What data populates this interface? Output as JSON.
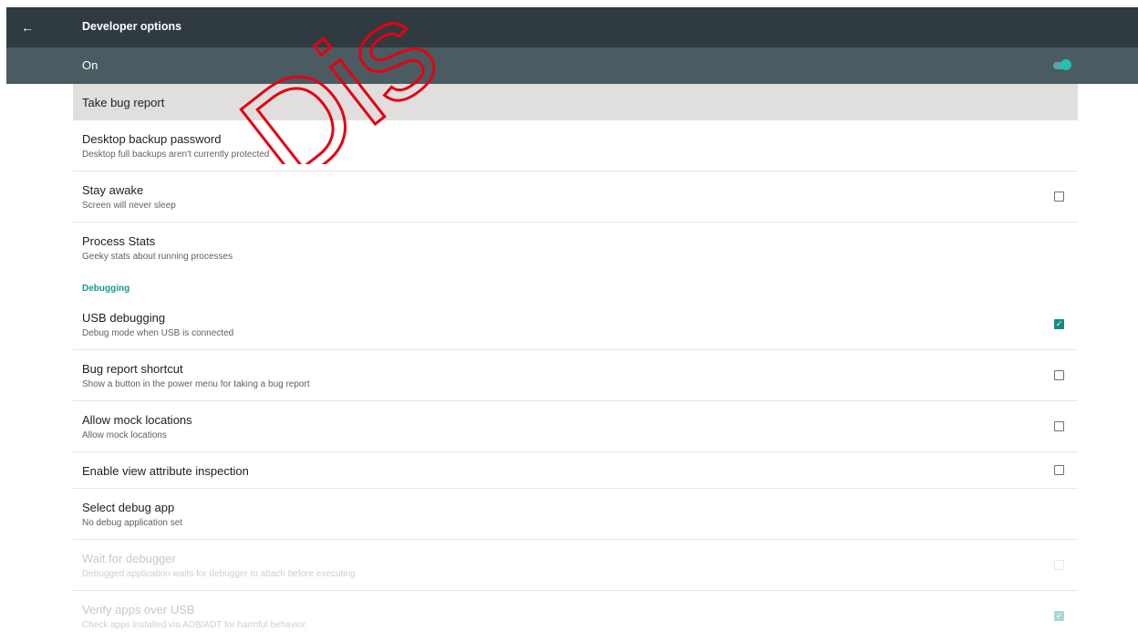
{
  "header": {
    "title": "Developer options",
    "back_icon": "arrow-left-icon"
  },
  "master_switch": {
    "label": "On",
    "on": true
  },
  "watermark": {
    "text": "Dis",
    "color": "#e60012"
  },
  "accent_color": "#16998f",
  "items": [
    {
      "title": "Take bug report",
      "highlighted": true
    },
    {
      "title": "Desktop backup password",
      "subtitle": "Desktop full backups aren't currently protected"
    },
    {
      "title": "Stay awake",
      "subtitle": "Screen will never sleep",
      "checkbox": false
    },
    {
      "title": "Process Stats",
      "subtitle": "Geeky stats about running processes"
    }
  ],
  "section_debugging": "Debugging",
  "debug_items": [
    {
      "title": "USB debugging",
      "subtitle": "Debug mode when USB is connected",
      "checkbox": true
    },
    {
      "title": "Bug report shortcut",
      "subtitle": "Show a button in the power menu for taking a bug report",
      "checkbox": false
    },
    {
      "title": "Allow mock locations",
      "subtitle": "Allow mock locations",
      "checkbox": false
    },
    {
      "title": "Enable view attribute inspection",
      "checkbox": false
    },
    {
      "title": "Select debug app",
      "subtitle": "No debug application set"
    },
    {
      "title": "Wait for debugger",
      "subtitle": "Debugged application waits for debugger to attach before executing",
      "checkbox": false,
      "disabled": true
    },
    {
      "title": "Verify apps over USB",
      "subtitle": "Check apps installed via ADB/ADT for harmful behavior.",
      "checkbox": true,
      "disabled": true
    }
  ]
}
